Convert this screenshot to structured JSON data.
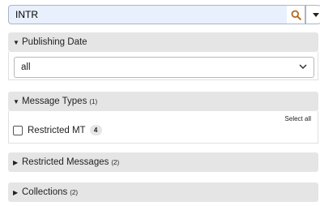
{
  "search": {
    "value": "INTR",
    "search_icon": "search-icon",
    "menu_icon": "caret-down-icon"
  },
  "facets": {
    "publishing_date": {
      "title": "Publishing Date",
      "expanded": true,
      "selected_option": "all"
    },
    "message_types": {
      "title": "Message Types",
      "count": "(1)",
      "expanded": true,
      "select_all_label": "Select all",
      "options": [
        {
          "label": "Restricted MT",
          "count": "4",
          "checked": false
        }
      ]
    },
    "restricted_messages": {
      "title": "Restricted Messages",
      "count": "(2)",
      "expanded": false
    },
    "collections": {
      "title": "Collections",
      "count": "(2)",
      "expanded": false
    }
  },
  "colors": {
    "search_bg": "#e8f0fe",
    "header_bg": "#e5e5e5",
    "search_icon_color": "#b5651d"
  }
}
